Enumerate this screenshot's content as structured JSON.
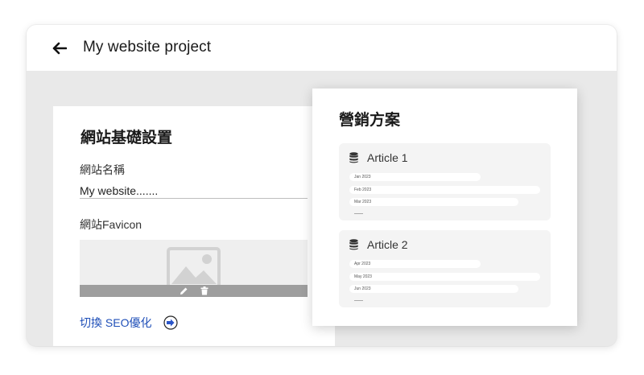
{
  "header": {
    "back_icon": "arrow-left-icon",
    "title": "My website project"
  },
  "settings": {
    "title": "網站基礎設置",
    "site_name_label": "網站名稱",
    "site_name_value": "My website.......",
    "favicon_label": "網站Favicon",
    "favicon_placeholder_icon": "image-placeholder-icon",
    "edit_icon": "pencil-icon",
    "delete_icon": "trash-icon",
    "seo_link_label": "切換 SEO優化",
    "seo_link_icon": "arrow-right-circle-icon",
    "link_color": "#1f4fb8"
  },
  "marketing": {
    "title": "營銷方案",
    "article_icon": "database-icon",
    "articles": [
      {
        "title": "Article 1",
        "months": [
          "Jan 2023",
          "Feb 2023",
          "Mar 2023"
        ]
      },
      {
        "title": "Article 2",
        "months": [
          "Apr 2023",
          "May 2023",
          "Jun 2023"
        ]
      }
    ]
  },
  "colors": {
    "background": "#e9e9e9",
    "card": "#ffffff",
    "article_card": "#f4f4f4",
    "upload_bar": "#9e9e9e"
  }
}
